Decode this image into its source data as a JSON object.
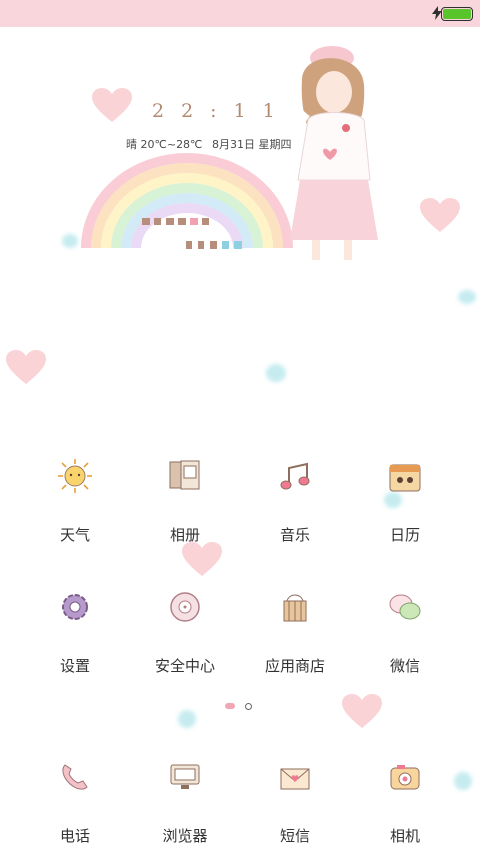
{
  "status_bar": {
    "battery_color": "#59c52a",
    "bg": "#f9d6dc"
  },
  "widget": {
    "time": "22:11",
    "weather": "晴 20℃~28℃",
    "date": "8月31日 星期四"
  },
  "apps_row1": [
    {
      "label": "天气",
      "icon": "sun-icon"
    },
    {
      "label": "相册",
      "icon": "photo-album-icon"
    },
    {
      "label": "音乐",
      "icon": "music-note-icon"
    },
    {
      "label": "日历",
      "icon": "calendar-icon"
    }
  ],
  "apps_row2": [
    {
      "label": "设置",
      "icon": "gear-icon"
    },
    {
      "label": "安全中心",
      "icon": "shield-disc-icon"
    },
    {
      "label": "应用商店",
      "icon": "store-basket-icon"
    },
    {
      "label": "微信",
      "icon": "wechat-bubbles-icon"
    }
  ],
  "dock": [
    {
      "label": "电话",
      "icon": "phone-icon"
    },
    {
      "label": "浏览器",
      "icon": "monitor-icon"
    },
    {
      "label": "短信",
      "icon": "envelope-icon"
    },
    {
      "label": "相机",
      "icon": "camera-icon"
    }
  ],
  "page_indicator": {
    "pages": 2,
    "current": 1
  }
}
